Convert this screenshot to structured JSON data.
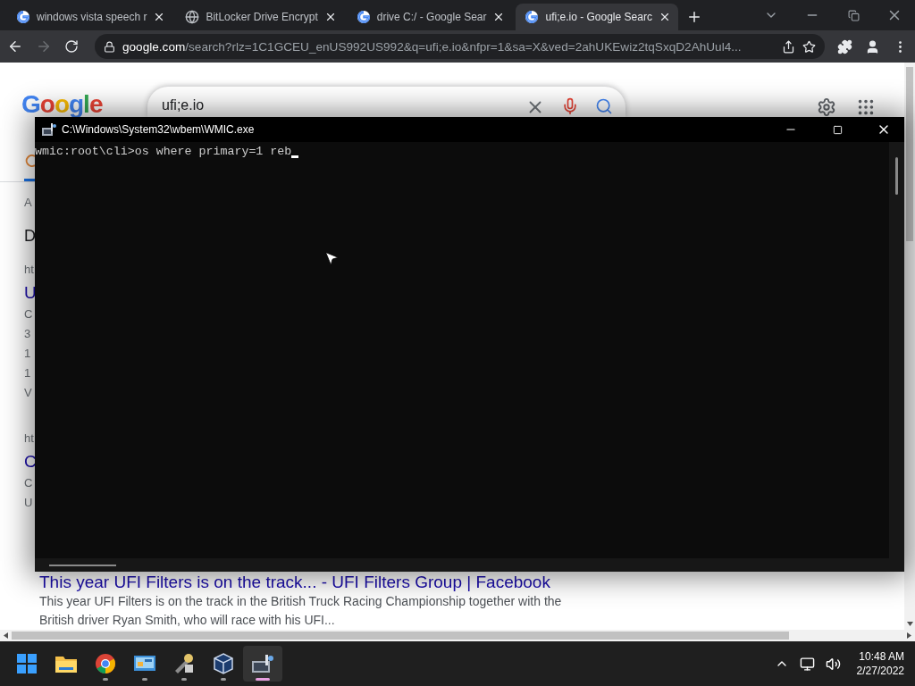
{
  "tabs": [
    {
      "title": "windows vista speech r",
      "kind": "google",
      "selected": false
    },
    {
      "title": "BitLocker Drive Encrypt",
      "kind": "globe",
      "selected": false
    },
    {
      "title": "drive C:/ - Google Sear",
      "kind": "google",
      "selected": false
    },
    {
      "title": "ufi;e.io - Google Searc",
      "kind": "google",
      "selected": true
    }
  ],
  "nav": {
    "forward_disabled": true
  },
  "address_bar": {
    "host": "google.com",
    "path": "/search?rlz=1C1GCEU_enUS992US992&q=ufi;e.io&nfpr=1&sa=X&ved=2ahUKEwiz2tqSxqD2AhUul4..."
  },
  "google": {
    "logo": "Google",
    "query": "ufi;e.io"
  },
  "results_peek": {
    "stats": "A",
    "heading": "D",
    "results": [
      {
        "url": "ht",
        "title": "U",
        "lines": [
          "C",
          "3",
          "1",
          "1",
          "V"
        ]
      },
      {
        "url": "ht",
        "title": "C",
        "lines": [
          "C",
          "U"
        ]
      }
    ]
  },
  "visible_result": {
    "title": "This year UFI Filters is on the track... - UFI Filters Group | Facebook",
    "snippet": "This year UFI Filters is on the track in the British Truck Racing Championship together with the British driver Ryan Smith, who will race with his UFI..."
  },
  "console": {
    "title": "C:\\Windows\\System32\\wbem\\WMIC.exe",
    "line": "wmic:root\\cli>os where primary=1 reb"
  },
  "taskbar": {
    "apps": [
      {
        "kind": "start",
        "running": false,
        "active": false
      },
      {
        "kind": "folder",
        "running": false,
        "active": false
      },
      {
        "kind": "chrome",
        "running": true,
        "active": false
      },
      {
        "kind": "panel",
        "running": true,
        "active": false
      },
      {
        "kind": "tool",
        "running": true,
        "active": false
      },
      {
        "kind": "cube",
        "running": true,
        "active": false
      },
      {
        "kind": "console",
        "running": true,
        "active": true
      }
    ],
    "time": "10:48 AM",
    "date": "2/27/2022"
  }
}
